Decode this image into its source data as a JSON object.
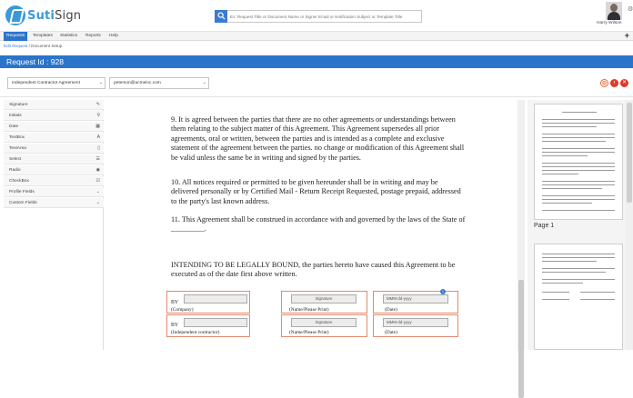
{
  "header": {
    "logo_text": "Sutisign",
    "logo_prefix": "Suti",
    "logo_suffix": "Sign",
    "search_placeholder": "Ex: Request Title or Document Name or Signer Email or Notification Subject or Template Title",
    "user_name": "Harry Wilson"
  },
  "menu": {
    "items": [
      "Requests",
      "Templates",
      "Statistics",
      "Reports",
      "Help"
    ],
    "add": "+"
  },
  "breadcrumb": {
    "link": "Edit Request",
    "separator": "/",
    "current": "Document Setup"
  },
  "title": "Request Id : 928",
  "selectors": {
    "document": "Independent Contractor Agreement",
    "signer": "peterson@acmeinc.com"
  },
  "fields": [
    {
      "label": "Signature",
      "icon": "✎"
    },
    {
      "label": "Initials",
      "icon": "⚲"
    },
    {
      "label": "Date",
      "icon": "▦"
    },
    {
      "label": "TextBox",
      "icon": "A"
    },
    {
      "label": "TextArea",
      "icon": "▯"
    },
    {
      "label": "Select",
      "icon": "☰"
    },
    {
      "label": "Radio",
      "icon": "◉"
    },
    {
      "label": "CheckBox",
      "icon": "☑"
    },
    {
      "label": "Profile Fields",
      "icon": "⌄"
    },
    {
      "label": "Custom Fields",
      "icon": "⌄"
    }
  ],
  "document": {
    "p9": "9.  It is agreed between the parties that there are no other agreements or understandings between them relating to the subject matter of this Agreement.  This Agreement supersedes all prior agreements, oral or written, between the parties and is intended as a complete and exclusive statement of the agreement between the parties.  no change or modification of this Agreement shall be valid unless the same be in writing and signed by the parties.",
    "p10": "10.  All notices required or permitted to be given hereunder shall be in writing and may be delivered personally or by Certified Mail - Return Receipt Requested, postage prepaid, addressed to the party's last known address.",
    "p11": "11.  This Agreement shall be construed in accordance with and governed by the laws of the State of _________.",
    "intending": "INTENDING TO BE LEGALLY BOUND, the parties hereto have caused this Agreement to be executed as of the date first above written.",
    "by": "BY",
    "company": "(Company)",
    "contractor": "(Independent contractor)",
    "name_print": "(Name/Please Print)",
    "date_label": "(Date)",
    "signature_btn": "Signature",
    "date_placeholder": "MMM-dd-yyyy"
  },
  "thumbnails": {
    "page_label": "Page 1"
  },
  "colors": {
    "brand_blue": "#2b74c9",
    "field_border": "#e48a6d"
  }
}
